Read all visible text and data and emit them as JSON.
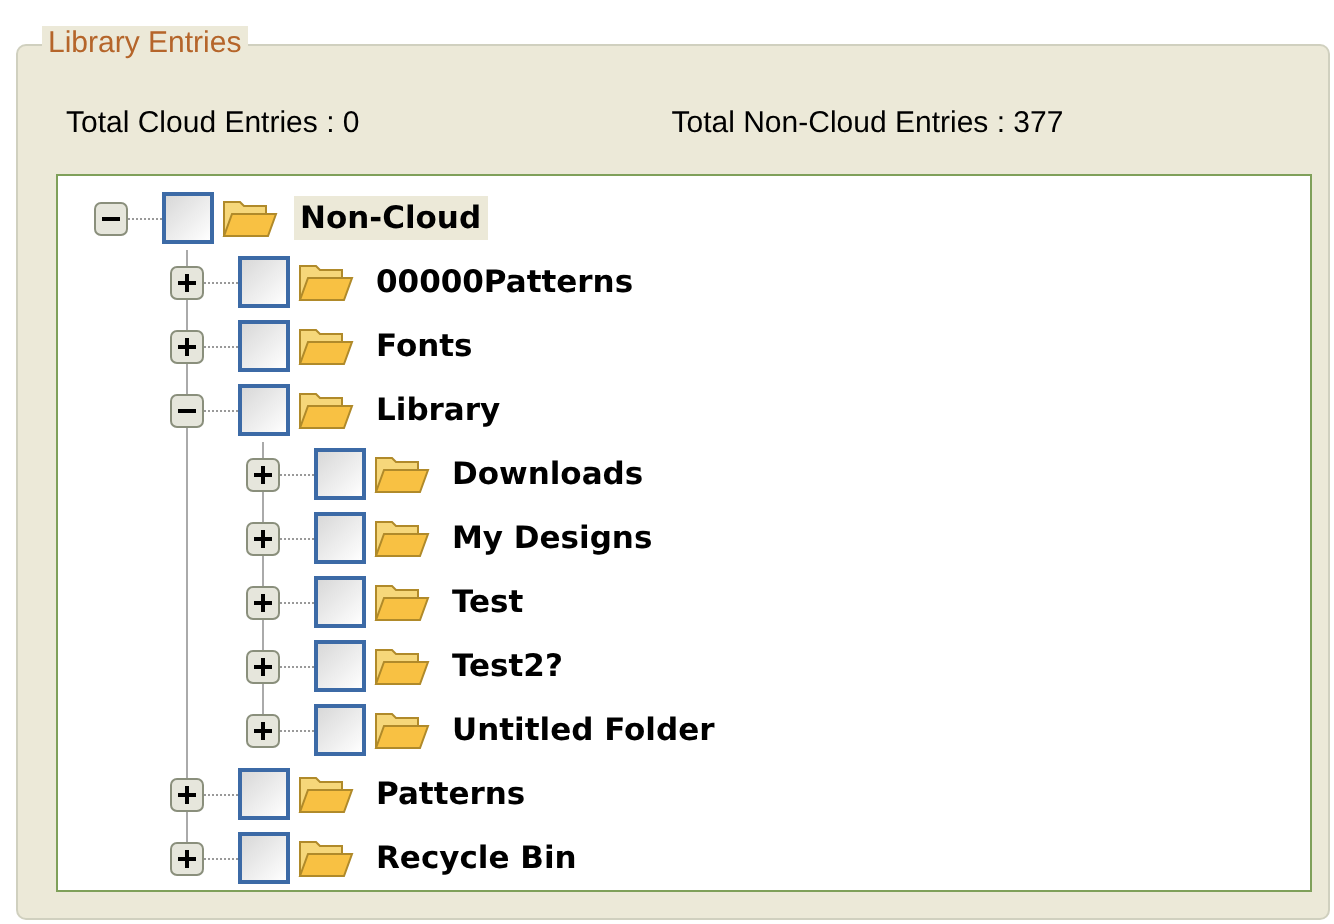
{
  "group": {
    "title": "Library Entries"
  },
  "totals": [
    "Total Cloud Entries : 0",
    "Total Non-Cloud Entries : 377"
  ],
  "tree": [
    {
      "label": "Non-Cloud",
      "expanded": true,
      "checked": false,
      "selected": true,
      "children": [
        {
          "label": "00000Patterns",
          "expanded": false,
          "checked": false,
          "selected": false
        },
        {
          "label": "Fonts",
          "expanded": false,
          "checked": false,
          "selected": false
        },
        {
          "label": "Library",
          "expanded": true,
          "checked": false,
          "selected": false,
          "children": [
            {
              "label": "Downloads",
              "expanded": false,
              "checked": false,
              "selected": false
            },
            {
              "label": "My Designs",
              "expanded": false,
              "checked": false,
              "selected": false
            },
            {
              "label": "Test",
              "expanded": false,
              "checked": false,
              "selected": false
            },
            {
              "label": "Test2?",
              "expanded": false,
              "checked": false,
              "selected": false
            },
            {
              "label": "Untitled Folder",
              "expanded": false,
              "checked": false,
              "selected": false
            }
          ]
        },
        {
          "label": "Patterns",
          "expanded": false,
          "checked": false,
          "selected": false
        },
        {
          "label": "Recycle Bin",
          "expanded": false,
          "checked": false,
          "selected": false
        }
      ]
    }
  ]
}
